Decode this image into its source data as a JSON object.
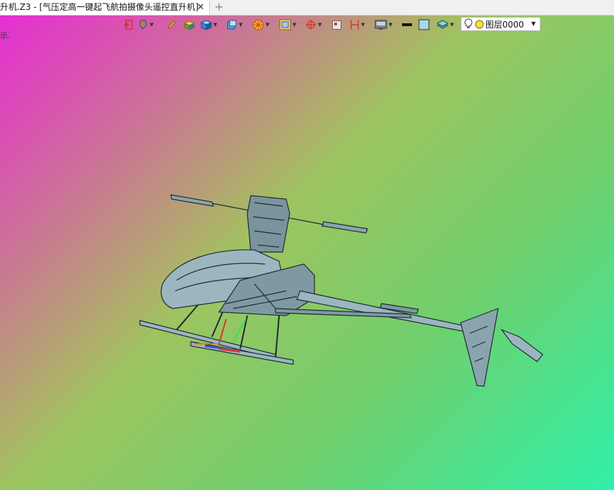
{
  "tab": {
    "title": "升机.Z3 - [气压定高一键起飞航拍摄像头遥控直升机]",
    "close_icon": "close-icon",
    "add_icon": "plus-icon"
  },
  "left_fragment": "示.",
  "toolbar": {
    "icons": [
      "exit-icon",
      "paint-bucket-icon",
      "pencil-icon",
      "box-yellow-icon",
      "cube-blue-icon",
      "cube-layers-icon",
      "sun-filter-icon",
      "frame-select-icon",
      "crosshair-icon",
      "rectangle-view-icon",
      "dimension-icon",
      "monitor-icon",
      "line-weight-icon",
      "color-swatch-icon",
      "layers-icon"
    ],
    "layer": {
      "value": "图层0000",
      "icons": [
        "lightbulb-icon",
        "sun-status-icon"
      ]
    },
    "colors": {
      "accent_red": "#d9362b",
      "accent_blue": "#3a86d6",
      "accent_yellow": "#f2c20c"
    }
  },
  "viewport": {
    "background_colors": [
      "#e42cd6",
      "#c8a060",
      "#6ed06e",
      "#2ff0a8"
    ],
    "model_fill": "#8aa4ad",
    "model_stroke": "#1d2b33"
  }
}
